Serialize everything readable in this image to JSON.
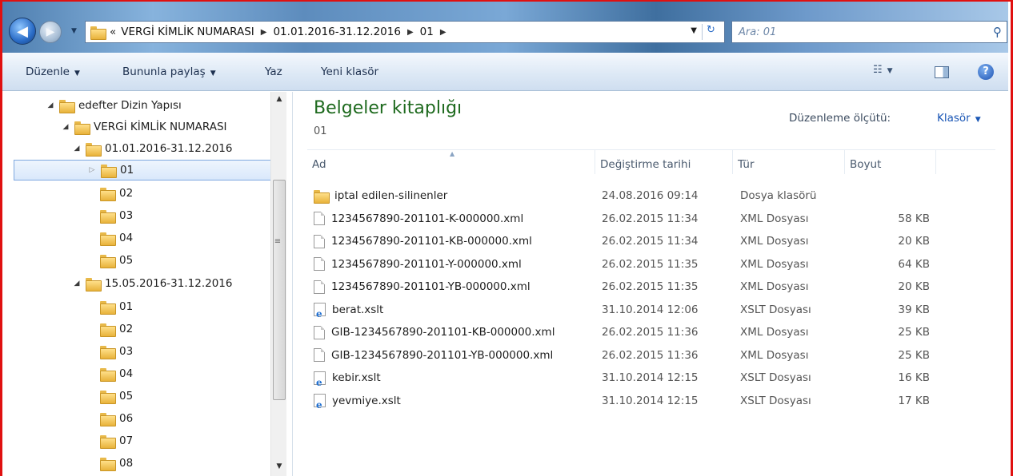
{
  "address": {
    "overflow": "«",
    "crumbs": [
      "VERGİ KİMLİK NUMARASI",
      "01.01.2016-31.12.2016",
      "01"
    ],
    "search_placeholder": "Ara: 01"
  },
  "toolbar": {
    "organize": "Düzenle",
    "share": "Bununla paylaş",
    "burn": "Yaz",
    "new_folder": "Yeni klasör"
  },
  "tree": [
    {
      "label": "edefter Dizin Yapısı",
      "expanded": true
    },
    {
      "label": "VERGİ KİMLİK NUMARASI",
      "expanded": true
    },
    {
      "label": "01.01.2016-31.12.2016",
      "expanded": true
    },
    {
      "label": "01",
      "selected": true
    },
    {
      "label": "02"
    },
    {
      "label": "03"
    },
    {
      "label": "04"
    },
    {
      "label": "05"
    },
    {
      "label": "15.05.2016-31.12.2016",
      "expanded": true
    },
    {
      "label": "01"
    },
    {
      "label": "02"
    },
    {
      "label": "03"
    },
    {
      "label": "04"
    },
    {
      "label": "05"
    },
    {
      "label": "06"
    },
    {
      "label": "07"
    },
    {
      "label": "08"
    }
  ],
  "library": {
    "title": "Belgeler kitaplığı",
    "subtitle": "01",
    "arrange_label": "Düzenleme ölçütü:",
    "arrange_value": "Klasör"
  },
  "columns": {
    "name": "Ad",
    "date": "Değiştirme tarihi",
    "type": "Tür",
    "size": "Boyut"
  },
  "files": [
    {
      "name": "iptal edilen-silinenler",
      "date": "24.08.2016 09:14",
      "type": "Dosya klasörü",
      "size": "",
      "icon": "folder-icon"
    },
    {
      "name": "1234567890-201101-K-000000.xml",
      "date": "26.02.2015 11:34",
      "type": "XML Dosyası",
      "size": "58 KB",
      "icon": "xml-file-icon"
    },
    {
      "name": "1234567890-201101-KB-000000.xml",
      "date": "26.02.2015 11:34",
      "type": "XML Dosyası",
      "size": "20 KB",
      "icon": "xml-file-icon"
    },
    {
      "name": "1234567890-201101-Y-000000.xml",
      "date": "26.02.2015 11:35",
      "type": "XML Dosyası",
      "size": "64 KB",
      "icon": "xml-file-icon"
    },
    {
      "name": "1234567890-201101-YB-000000.xml",
      "date": "26.02.2015 11:35",
      "type": "XML Dosyası",
      "size": "20 KB",
      "icon": "xml-file-icon"
    },
    {
      "name": "berat.xslt",
      "date": "31.10.2014 12:06",
      "type": "XSLT Dosyası",
      "size": "39 KB",
      "icon": "xslt-file-icon"
    },
    {
      "name": "GIB-1234567890-201101-KB-000000.xml",
      "date": "26.02.2015 11:36",
      "type": "XML Dosyası",
      "size": "25 KB",
      "icon": "xml-file-icon"
    },
    {
      "name": "GIB-1234567890-201101-YB-000000.xml",
      "date": "26.02.2015 11:36",
      "type": "XML Dosyası",
      "size": "25 KB",
      "icon": "xml-file-icon"
    },
    {
      "name": "kebir.xslt",
      "date": "31.10.2014 12:15",
      "type": "XSLT Dosyası",
      "size": "16 KB",
      "icon": "xslt-file-icon"
    },
    {
      "name": "yevmiye.xslt",
      "date": "31.10.2014 12:15",
      "type": "XSLT Dosyası",
      "size": "17 KB",
      "icon": "xslt-file-icon"
    }
  ]
}
